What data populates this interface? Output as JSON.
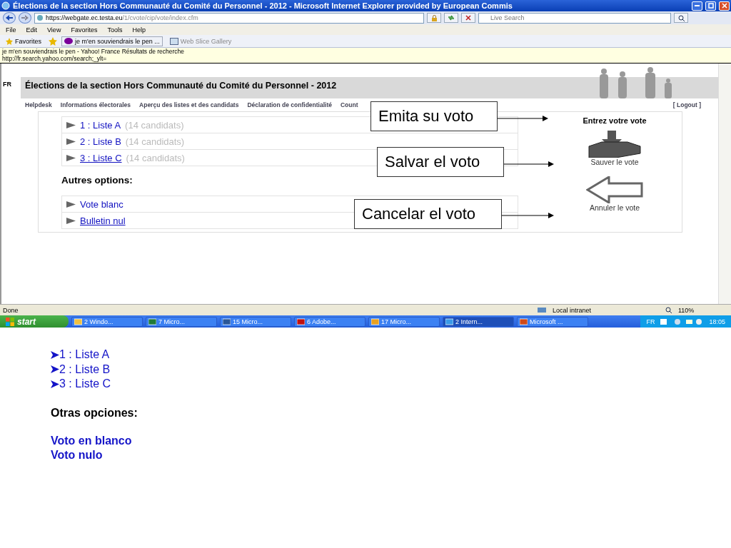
{
  "window": {
    "title": "Élections de la section Hors Communauté du Comité du Personnel - 2012 - Microsoft Internet Explorer provided by European Commis"
  },
  "address_bar": {
    "url_host": "https://webgate.ec.testa.eu",
    "url_path": "/1/cvote/cip/vote/index.cfm",
    "search_placeholder": "Live Search"
  },
  "menu": [
    "File",
    "Edit",
    "View",
    "Favorites",
    "Tools",
    "Help"
  ],
  "favorites_bar": {
    "label": "Favorites",
    "items": [
      {
        "kind": "yahoo",
        "label": "je m'en souviendrais le pen ..."
      },
      {
        "kind": "slice",
        "label": "Web Slice Gallery"
      }
    ]
  },
  "tooltip": {
    "lines": [
      "je m'en souviendrais le pen - Yahoo! France Résultats de recherche",
      "http://fr.search.yahoo.com/search;_ylt="
    ]
  },
  "page": {
    "language": "FR",
    "header_title": "Élections de la section Hors Communauté du Comité du Personnel - 2012",
    "nav": [
      "Helpdesk",
      "Informations électorales",
      "Aperçu des listes et des candidats",
      "Déclaration de confidentialité",
      "Count"
    ],
    "logout": "[ Logout ]",
    "lists": [
      {
        "label": "1 : Liste A",
        "count": "(14 candidats)",
        "underlined": false
      },
      {
        "label": "2 : Liste B",
        "count": "(14 candidats)",
        "underlined": false
      },
      {
        "label": "3 : Liste C",
        "count": "(14 candidats)",
        "underlined": true
      }
    ],
    "other_heading": "Autres options:",
    "options": [
      {
        "label": "Vote blanc",
        "underlined": false
      },
      {
        "label": "Bulletin nul",
        "underlined": true
      }
    ],
    "vote_heading": "Entrez votre vote",
    "actions": [
      {
        "kind": "save",
        "label": "Sauver le vote"
      },
      {
        "kind": "cancel",
        "label": "Annuler le vote"
      }
    ]
  },
  "callouts": [
    "Emita su voto",
    "Salvar el voto",
    "Cancelar el voto"
  ],
  "status_bar": {
    "status": "Done",
    "zone": "Local intranet",
    "zoom": "110%"
  },
  "taskbar": {
    "start": "start",
    "tasks": [
      {
        "kind": "folder",
        "label": "2 Windo..."
      },
      {
        "kind": "excel",
        "label": "7 Micro..."
      },
      {
        "kind": "word",
        "label": "15 Micro..."
      },
      {
        "kind": "pdf",
        "label": "6 Adobe..."
      },
      {
        "kind": "outlook",
        "label": "17 Micro..."
      },
      {
        "kind": "ie",
        "label": "2 Intern..."
      },
      {
        "kind": "ppt",
        "label": "Microsoft ..."
      }
    ],
    "language": "FR",
    "clock": "18:05"
  },
  "slide_notes": {
    "lists": [
      "1 : Liste A",
      "2 : Liste B",
      "3 : Liste C"
    ],
    "heading": "Otras opciones:",
    "options": [
      "Voto en blanco",
      "Voto nulo"
    ]
  }
}
